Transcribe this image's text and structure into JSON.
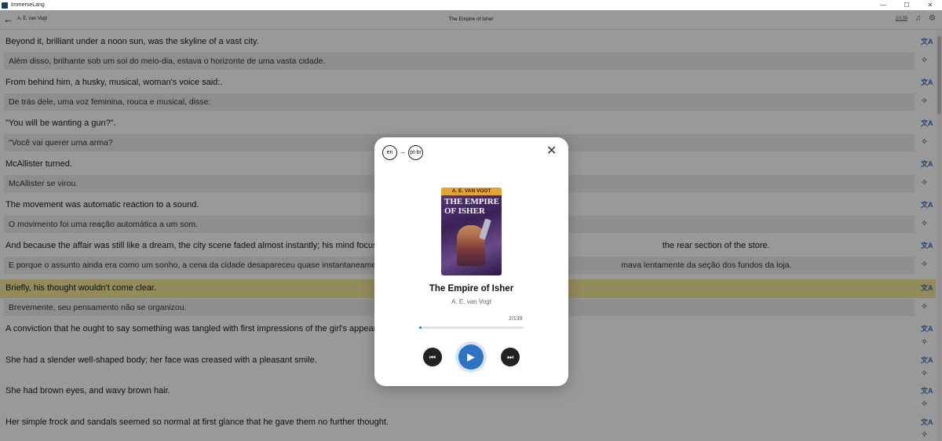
{
  "window": {
    "title": "ImmerseLang",
    "controls": {
      "minimize": "—",
      "maximize": "☐",
      "close": "✕"
    }
  },
  "header": {
    "back_icon": "arrow-left-icon",
    "author": "A. E. van Vogt",
    "title": "The Empire of Isher",
    "pager": "2/139"
  },
  "lines": [
    {
      "source": "Beyond it, brilliant under a noon sun, was the skyline of a vast city.",
      "translation": "Além disso, brilhante sob um sol do meio-dia, estava o horizonte de uma vasta cidade."
    },
    {
      "source": "From behind him, a husky, musical, woman's voice said:.",
      "translation": "De trás dele, uma voz feminina, rouca e musical, disse:"
    },
    {
      "source": "\"You will be wanting a gun?\".",
      "translation": "\"Você vai querer uma arma?"
    },
    {
      "source": "McAllister turned.",
      "translation": "McAllister se virou."
    },
    {
      "source": "The movement was automatic reaction to a sound.",
      "translation": "O movimento foi uma reação automática a um som."
    },
    {
      "source": "And because the affair was still like a dream, the city scene faded almost instantly; his mind focused c                                                                                                                the rear section of the store.",
      "translation": "E porque o assunto ainda era como um sonho, a cena da cidade desapareceu quase instantaneamen                                                                                                         mava lentamente da seção dos fundos da loja."
    },
    {
      "source": "Briefly, his thought wouldn't come clear.",
      "translation": "Brevemente, seu pensamento não se organizou.",
      "highlighted": true
    },
    {
      "source": "A conviction that he ought to say something was tangled with first impressions of the girl's appearan"
    },
    {
      "source": "She had a slender well-shaped body; her face was creased with a pleasant smile."
    },
    {
      "source": "She had brown eyes, and wavy brown hair."
    },
    {
      "source": "Her simple frock and sandals seemed so normal at first glance that he gave them no further thought."
    }
  ],
  "modal": {
    "source_lang": "en",
    "target_lang": "pt-br",
    "arrow": "→",
    "close": "✕",
    "cover_author": "A. E. VAN VOGT",
    "cover_title_1": "THE EMPIRE",
    "cover_title_2": "OF ISHER",
    "title": "The Empire of Isher",
    "author": "A. E. van Vogt",
    "count": "2/139",
    "progress": 0.014,
    "prev_icon": "skip-previous-icon",
    "play_icon": "play-icon",
    "next_icon": "skip-next-icon"
  },
  "colors": {
    "accent": "#2f74c0",
    "highlight": "#f4e89a",
    "translation_bg": "#ededed"
  }
}
